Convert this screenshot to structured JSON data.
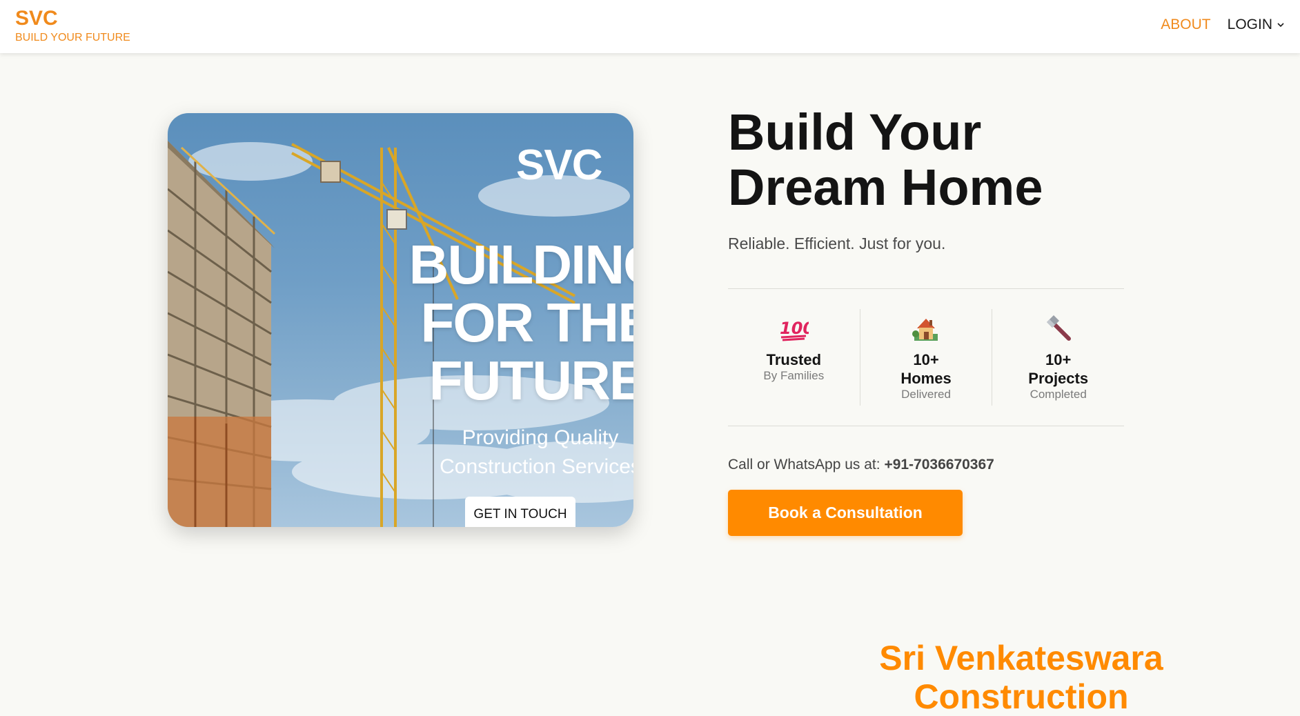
{
  "header": {
    "brand_name": "SVC",
    "brand_tagline": "BUILD YOUR FUTURE",
    "nav_about": "ABOUT",
    "nav_login": "LOGIN"
  },
  "hero_card": {
    "logo_text": "SVC",
    "headline_line1": "BUILDING",
    "headline_line2": "FOR THE",
    "headline_line3": "FUTURE",
    "subtitle_line1": "Providing Quality",
    "subtitle_line2": "Construction Services",
    "cta_label": "GET IN TOUCH"
  },
  "hero": {
    "title_line1": "Build Your",
    "title_line2": "Dream Home",
    "tagline": "Reliable. Efficient. Just for you."
  },
  "stats": [
    {
      "icon": "hundred-points-icon",
      "main": "Trusted",
      "sub": "By Families"
    },
    {
      "icon": "house-icon",
      "main_line1": "10+",
      "main_line2": "Homes",
      "sub": "Delivered"
    },
    {
      "icon": "hammer-icon",
      "main_line1": "10+",
      "main_line2": "Projects",
      "sub": "Completed"
    }
  ],
  "contact": {
    "prefix": "Call or WhatsApp us at:",
    "phone": "+91-7036670367"
  },
  "book_button": "Book a Consultation",
  "company_name_line1": "Sri Venkateswara",
  "company_name_line2": "Construction",
  "colors": {
    "accent": "#ff8a00",
    "brand_orange": "#f08a1c",
    "background": "#f9f9f5"
  }
}
